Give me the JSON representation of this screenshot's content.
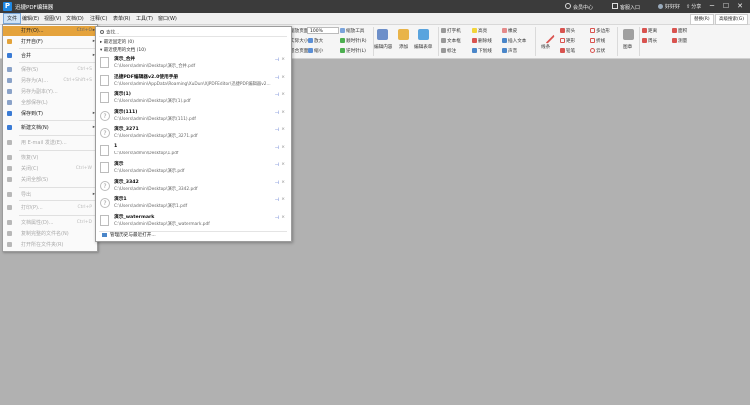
{
  "titlebar": {
    "logo": "P",
    "title": "迅捷PDF编辑器",
    "member": "会员中心",
    "login": "客服入口",
    "user": "好好好",
    "share": "分享",
    "min": "─",
    "max": "☐",
    "close": "✕"
  },
  "menubar": [
    "文件",
    "编辑(E)",
    "视图(V)",
    "文档(D)",
    "注释(C)",
    "表单(R)",
    "工具(T)",
    "窗口(W)"
  ],
  "ribbon": {
    "zoom_value": "100%",
    "labels": {
      "page_label": "缩放页面",
      "actual_size": "实际大小",
      "zoom_tools": "缩放工具",
      "fit_page": "适合页面",
      "fit_width": "适合宽度",
      "fit_visible": "适合可视",
      "zoom_in": "放大",
      "zoom_out": "缩小",
      "rotate_cw": "顺时针(R)",
      "rotate_ccw": "逆时针(L)",
      "edit_content": "编辑内容",
      "add": "添加",
      "form_edit": "编辑表单",
      "typewriter": "打字机",
      "textbox": "文本框",
      "callout": "标注",
      "highlight": "高亮",
      "strikeout": "删除线",
      "underline": "下划线",
      "eraser": "橡皮",
      "insert_text": "插入文本",
      "sound": "声音",
      "pen": "铅笔",
      "line": "线条",
      "arrow": "箭头",
      "polyline": "折线",
      "polygon": "多边形",
      "rect": "矩形",
      "ellipse": "椭圆",
      "cloud": "云状",
      "stamp": "图章",
      "measure": "测量",
      "distance": "距离",
      "perimeter": "周长",
      "area": "面积"
    },
    "right_pills": [
      "替换(R)",
      "高级搜索(G)"
    ]
  },
  "file_menu": [
    {
      "label": "打开(O)...",
      "shortcut": "Ctrl+O",
      "submenu": true,
      "state": "highlight",
      "icon_color": "#e3a33a"
    },
    {
      "label": "打开自(F)",
      "shortcut": "",
      "submenu": true,
      "state": "normal",
      "icon_color": "#e3a33a"
    },
    {
      "label": "合并",
      "shortcut": "",
      "submenu": true,
      "state": "normal",
      "icon_color": "#3a7bd5"
    },
    {
      "label": "保存(S)",
      "shortcut": "Ctrl+S",
      "submenu": false,
      "state": "disabled",
      "icon_color": "#8aa2c8"
    },
    {
      "label": "另存为(A)...",
      "shortcut": "Ctrl+Shift+S",
      "submenu": false,
      "state": "disabled",
      "icon_color": "#8aa2c8"
    },
    {
      "label": "另存为副本(Y)...",
      "shortcut": "",
      "submenu": false,
      "state": "disabled",
      "icon_color": "#8aa2c8"
    },
    {
      "label": "全部保存(L)",
      "shortcut": "",
      "submenu": false,
      "state": "disabled",
      "icon_color": "#8aa2c8"
    },
    {
      "label": "保存到(T)",
      "shortcut": "",
      "submenu": true,
      "state": "normal",
      "icon_color": "#3a7bd5"
    },
    {
      "label": "新建文档(N)",
      "shortcut": "",
      "submenu": true,
      "state": "normal",
      "icon_color": "#3a7bd5"
    },
    {
      "label": "用 E-mail 发送(E)...",
      "shortcut": "",
      "submenu": false,
      "state": "disabled",
      "icon_color": "#b8b8b8"
    },
    {
      "label": "恢复(V)",
      "shortcut": "",
      "submenu": false,
      "state": "disabled",
      "icon_color": "#b8b8b8"
    },
    {
      "label": "关闭(C)",
      "shortcut": "Ctrl+W",
      "submenu": false,
      "state": "disabled",
      "icon_color": "#b8b8b8"
    },
    {
      "label": "关闭全部(S)",
      "shortcut": "",
      "submenu": false,
      "state": "disabled",
      "icon_color": "#b8b8b8"
    },
    {
      "label": "导出",
      "shortcut": "",
      "submenu": true,
      "state": "disabled",
      "icon_color": "#b8b8b8"
    },
    {
      "label": "打印(P)...",
      "shortcut": "Ctrl+P",
      "submenu": false,
      "state": "disabled",
      "icon_color": "#b8b8b8"
    },
    {
      "label": "文档属性(D)...",
      "shortcut": "Ctrl+D",
      "submenu": false,
      "state": "disabled",
      "icon_color": "#b8b8b8"
    },
    {
      "label": "复制完整的文件名(N)",
      "shortcut": "",
      "submenu": false,
      "state": "disabled",
      "icon_color": "#b8b8b8"
    },
    {
      "label": "打开所在文件夹(R)",
      "shortcut": "",
      "submenu": false,
      "state": "disabled",
      "icon_color": "#b8b8b8"
    }
  ],
  "recent_menu": {
    "search_placeholder": "查找...",
    "group_pinned": "最近固定的 (0)",
    "group_recent": "最近使用的文档 (10)",
    "files": [
      {
        "name": "演示_合并",
        "path": "C:\\Users\\admin\\Desktop\\演示_合并.pdf",
        "icon": "doc"
      },
      {
        "name": "迅捷PDF编辑器v2.0使用手册",
        "path": "C:\\Users\\admin\\AppData\\Roaming\\XuDun\\XJPDFEditor\\迅捷PDF编辑器v2...",
        "icon": "doc"
      },
      {
        "name": "演示(1)",
        "path": "C:\\Users\\admin\\Desktop\\演示(1).pdf",
        "icon": "doc"
      },
      {
        "name": "演示(111)",
        "path": "C:\\Users\\admin\\Desktop\\演示(111).pdf",
        "icon": "missing"
      },
      {
        "name": "演示_3271",
        "path": "C:\\Users\\admin\\Desktop\\演示_3271.pdf",
        "icon": "missing"
      },
      {
        "name": "1",
        "path": "C:\\Users\\admin\\Desktop\\1.pdf",
        "icon": "doc"
      },
      {
        "name": "演示",
        "path": "C:\\Users\\admin\\Desktop\\演示.pdf",
        "icon": "doc"
      },
      {
        "name": "演示_3342",
        "path": "C:\\Users\\admin\\Desktop\\演示_3342.pdf",
        "icon": "missing"
      },
      {
        "name": "演示1",
        "path": "C:\\Users\\admin\\Desktop\\演示1.pdf",
        "icon": "missing"
      },
      {
        "name": "演示_watermark",
        "path": "C:\\Users\\admin\\Desktop\\演示_watermark.pdf",
        "icon": "doc"
      }
    ],
    "pin_glyph": "⊣",
    "remove_glyph": "×",
    "manage_label": "管理历史与最近打开..."
  },
  "colors": {
    "titlebar": "#3b3b3b",
    "workspace": "#b1b1b1",
    "highlight": "#e5a33c",
    "pin": "#3a5bc7"
  }
}
